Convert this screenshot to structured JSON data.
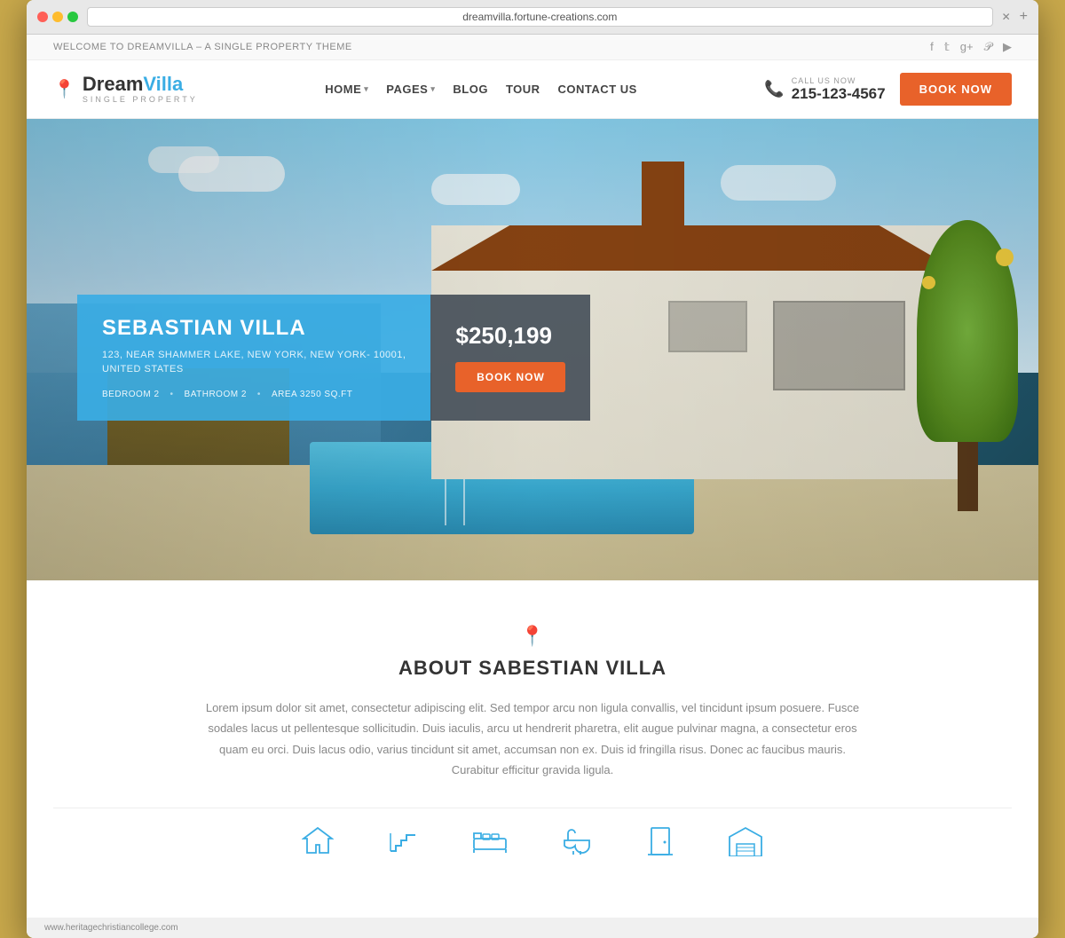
{
  "browser": {
    "address": "dreamvilla.fortune-creations.com",
    "close_icon": "✕",
    "add_tab_icon": "+"
  },
  "topbar": {
    "welcome_text": "WELCOME TO DREAMVILLA – A SINGLE PROPERTY THEME",
    "social": [
      {
        "name": "facebook",
        "icon": "f"
      },
      {
        "name": "twitter",
        "icon": "t"
      },
      {
        "name": "google-plus",
        "icon": "g+"
      },
      {
        "name": "pinterest",
        "icon": "p"
      },
      {
        "name": "youtube",
        "icon": "▶"
      }
    ]
  },
  "header": {
    "logo_main": "DreamVilla",
    "logo_highlight": "Villa",
    "logo_sub": "SINGLE PROPERTY",
    "nav_items": [
      {
        "label": "HOME",
        "has_dropdown": true
      },
      {
        "label": "PAGES",
        "has_dropdown": true
      },
      {
        "label": "BLOG",
        "has_dropdown": false
      },
      {
        "label": "TOUR",
        "has_dropdown": false
      },
      {
        "label": "CONTACT US",
        "has_dropdown": false
      }
    ],
    "call_label": "CALL US NOW",
    "phone": "215-123-4567",
    "book_btn": "BOOK NOW"
  },
  "hero": {
    "villa_name": "SEBASTIAN VILLA",
    "address_line1": "123, NEAR SHAMMER LAKE, NEW YORK, NEW YORK- 10001,",
    "address_line2": "UNITED STATES",
    "bedroom": "BEDROOM  2",
    "bathroom": "BATHROOM  2",
    "area": "AREA  3250 SQ.FT",
    "price": "$250,199",
    "book_btn": "BOOK NOW"
  },
  "about": {
    "title": "ABOUT SABESTIAN VILLA",
    "body": "Lorem ipsum dolor sit amet, consectetur adipiscing elit. Sed tempor arcu non ligula convallis, vel tincidunt ipsum posuere. Fusce sodales lacus ut pellentesque sollicitudin. Duis iaculis, arcu ut hendrerit pharetra, elit augue pulvinar magna, a consectetur eros quam eu orci. Duis lacus odio, varius tincidunt sit amet, accumsan non ex. Duis id fringilla risus. Donec ac faucibus mauris. Curabitur efficitur gravida ligula."
  },
  "feature_icons": [
    {
      "name": "house-icon",
      "symbol": "⌂"
    },
    {
      "name": "stairs-icon",
      "symbol": "⇗"
    },
    {
      "name": "bed-icon",
      "symbol": "▭"
    },
    {
      "name": "bath-icon",
      "symbol": "♨"
    },
    {
      "name": "door-icon",
      "symbol": "▯"
    },
    {
      "name": "garage-icon",
      "symbol": "⌂"
    }
  ],
  "footer": {
    "url": "www.heritagechristiancollege.com"
  }
}
